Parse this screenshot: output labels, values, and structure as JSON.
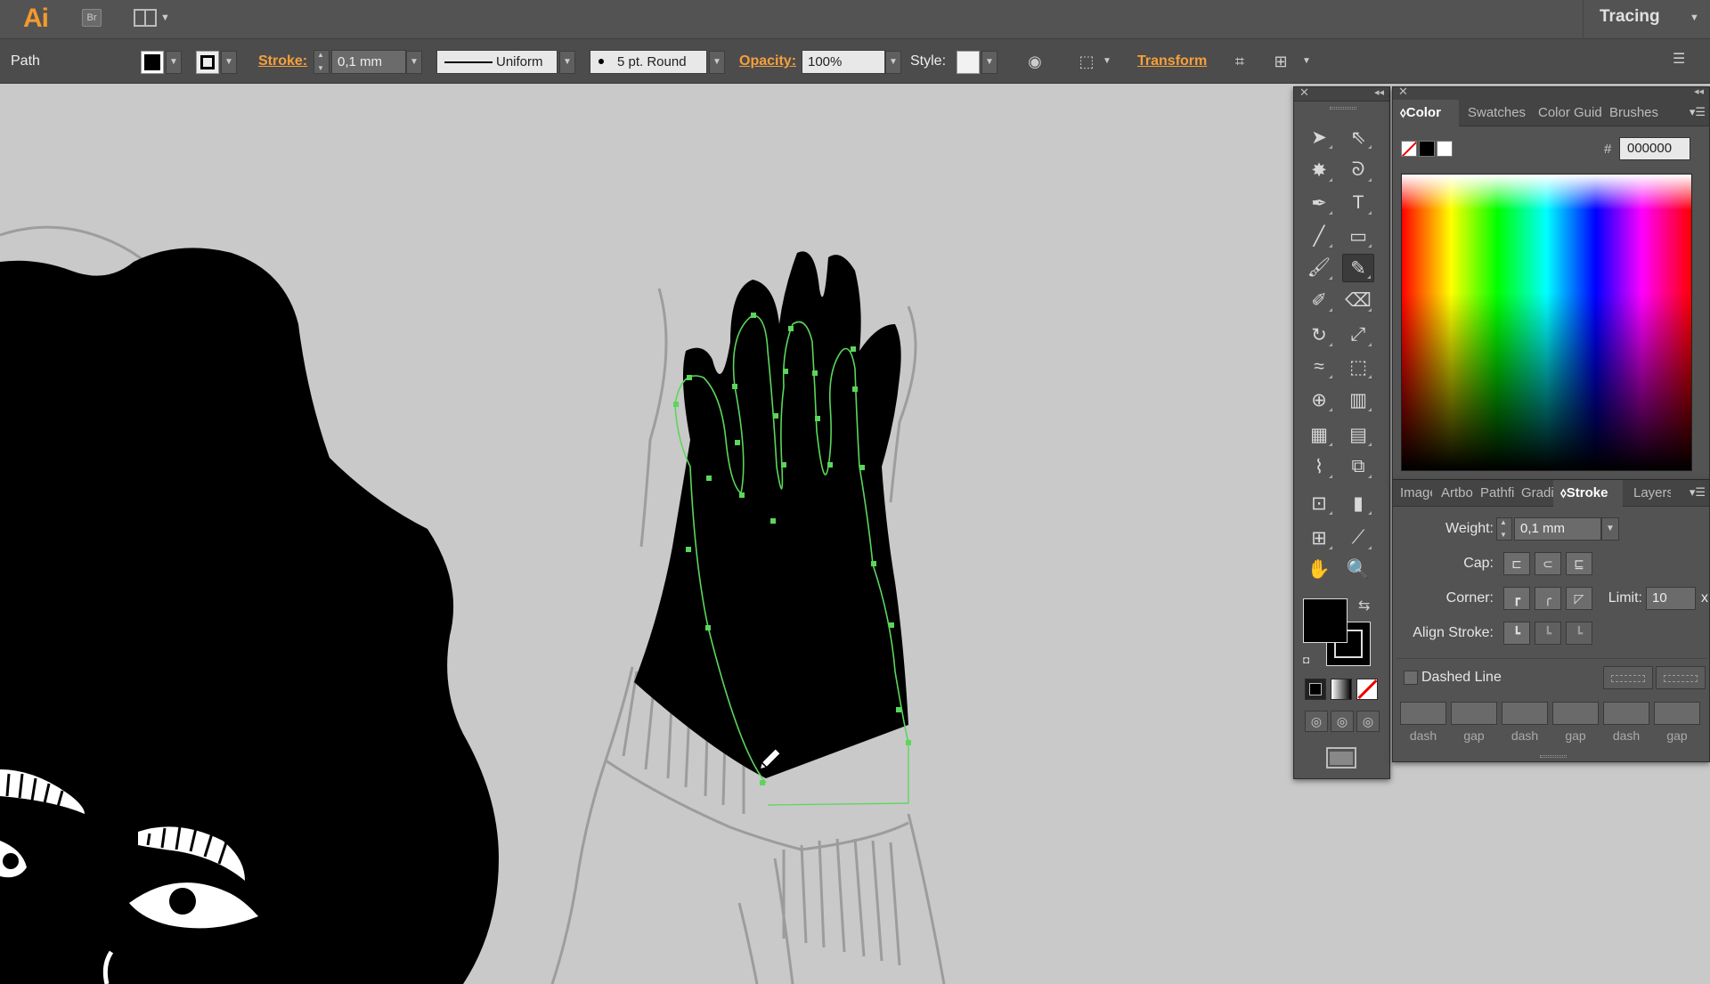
{
  "app": {
    "logo": "Ai",
    "bridge_label": "Br",
    "workspace": "Tracing"
  },
  "control_bar": {
    "selection_label": "Path",
    "stroke_label": "Stroke:",
    "stroke_weight": "0,1 mm",
    "variable_width_profile": "Uniform",
    "brush": "5 pt. Round",
    "opacity_label": "Opacity:",
    "opacity_value": "100%",
    "style_label": "Style:",
    "transform_label": "Transform"
  },
  "color_panel": {
    "tabs": [
      "Color",
      "Swatches",
      "Color Guide",
      "Brushes"
    ],
    "active_tab": "Color",
    "hex_label": "#",
    "hex_value": "000000"
  },
  "stroke_panel": {
    "tabs": [
      "Image Trace",
      "Artboards",
      "Pathfinder",
      "Gradient",
      "Stroke",
      "Layers"
    ],
    "active_tab": "Stroke",
    "weight_label": "Weight:",
    "weight_value": "0,1 mm",
    "cap_label": "Cap:",
    "corner_label": "Corner:",
    "limit_label": "Limit:",
    "limit_value": "10",
    "limit_suffix": "x",
    "align_label": "Align Stroke:",
    "dashed_line_label": "Dashed Line",
    "dash_labels": [
      "dash",
      "gap",
      "dash",
      "gap",
      "dash",
      "gap"
    ]
  },
  "colors": {
    "accent_orange": "#f5a03c",
    "path_green": "#5bd65b",
    "fill": "#000000"
  }
}
